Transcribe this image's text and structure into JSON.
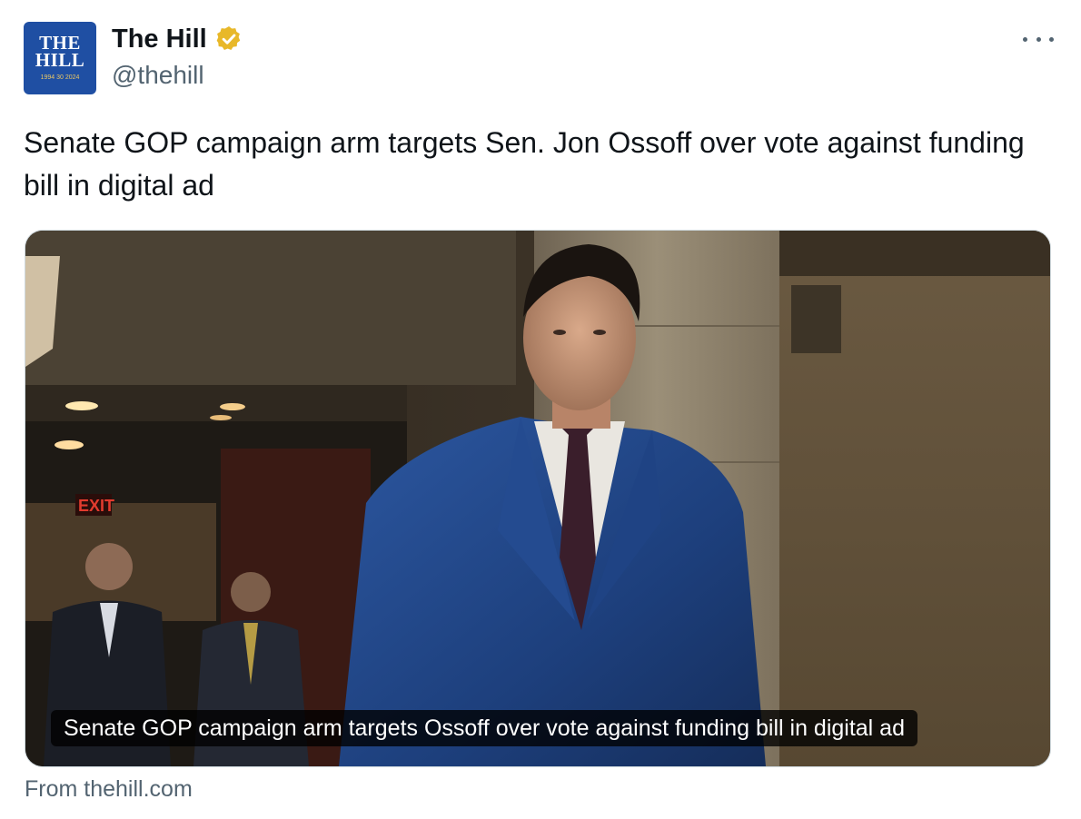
{
  "author": {
    "display_name": "The Hill",
    "handle": "@thehill",
    "verified_icon": "verified-badge-gold",
    "avatar": {
      "line1": "THE",
      "line2": "HILL",
      "line3": "1994 30 2024",
      "background": "#1f4fa3"
    }
  },
  "menu": {
    "icon": "more-horizontal-icon"
  },
  "tweet": {
    "text": "Senate GOP campaign arm targets Sen. Jon Ossoff over vote against funding bill in digital ad"
  },
  "card": {
    "caption": "Senate GOP campaign arm targets Ossoff over vote against funding bill in digital ad",
    "source": "From thehill.com",
    "image_icon": "news-photo"
  },
  "colors": {
    "text_primary": "#0f1419",
    "text_secondary": "#536471",
    "border": "#cfd9de",
    "verified_gold": "#e8b829"
  }
}
